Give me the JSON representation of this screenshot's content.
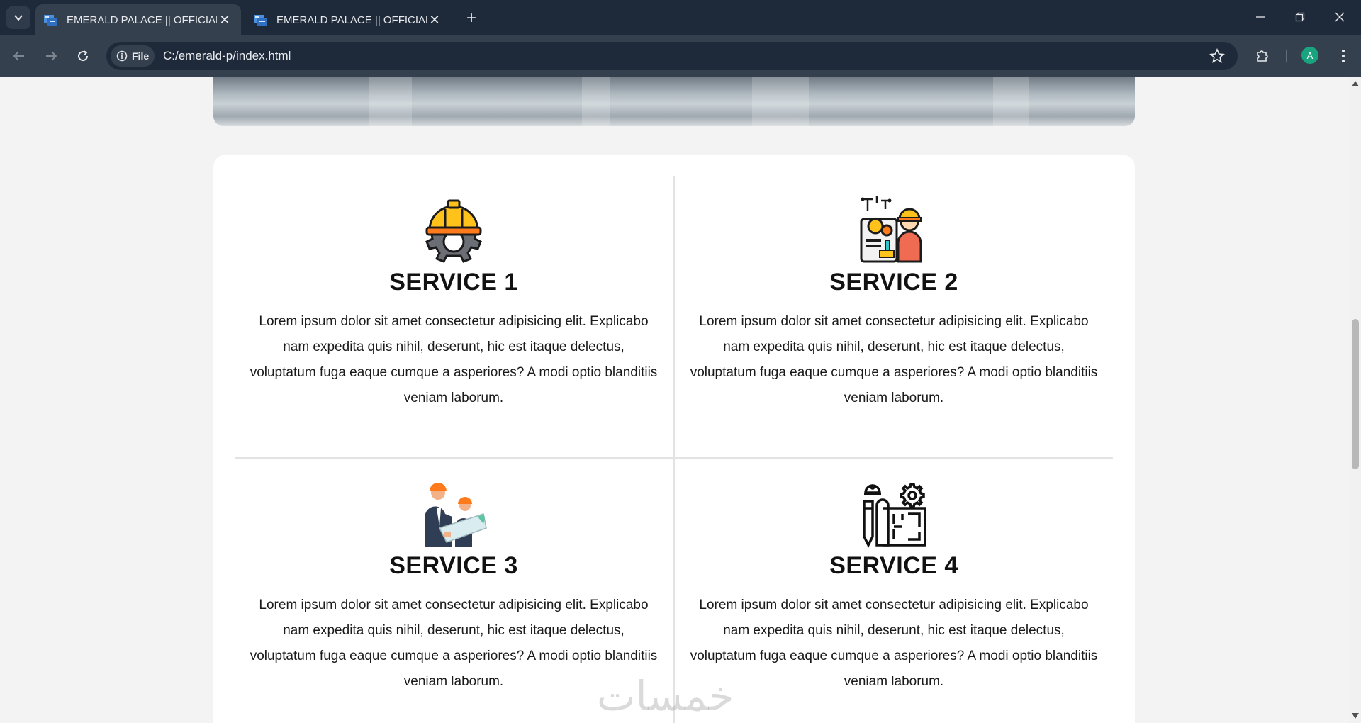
{
  "browser": {
    "tabs": [
      {
        "title": "EMERALD PALACE || OFFICIAL",
        "active": true
      },
      {
        "title": "EMERALD PALACE || OFFICIAL",
        "active": false
      }
    ],
    "site_chip_label": "File",
    "url": "C:/emerald-p/index.html",
    "profile_initial": "A"
  },
  "services": [
    {
      "icon": "engineer-helmet-gear-icon",
      "title": "SERVICE 1",
      "text": "Lorem ipsum dolor sit amet consectetur adipisicing elit. Explicabo nam expedita quis nihil, deserunt, hic est itaque delectus, voluptatum fuga eaque cumque a asperiores? A modi optio blanditiis veniam laborum."
    },
    {
      "icon": "engineer-worker-machine-icon",
      "title": "SERVICE 2",
      "text": "Lorem ipsum dolor sit amet consectetur adipisicing elit. Explicabo nam expedita quis nihil, deserunt, hic est itaque delectus, voluptatum fuga eaque cumque a asperiores? A modi optio blanditiis veniam laborum."
    },
    {
      "icon": "engineers-blueprint-icon",
      "title": "SERVICE 3",
      "text": "Lorem ipsum dolor sit amet consectetur adipisicing elit. Explicabo nam expedita quis nihil, deserunt, hic est itaque delectus, voluptatum fuga eaque cumque a asperiores? A modi optio blanditiis veniam laborum."
    },
    {
      "icon": "architecture-plan-icon",
      "title": "SERVICE 4",
      "text": "Lorem ipsum dolor sit amet consectetur adipisicing elit. Explicabo nam expedita quis nihil, deserunt, hic est itaque delectus, voluptatum fuga eaque cumque a asperiores? A modi optio blanditiis veniam laborum."
    }
  ],
  "watermark": "خمسات",
  "colors": {
    "tabbar": "#1e2a3a",
    "toolbar": "#35404f",
    "page_bg": "#f3f3f3",
    "card_bg": "#ffffff",
    "avatar": "#1aa37f"
  }
}
